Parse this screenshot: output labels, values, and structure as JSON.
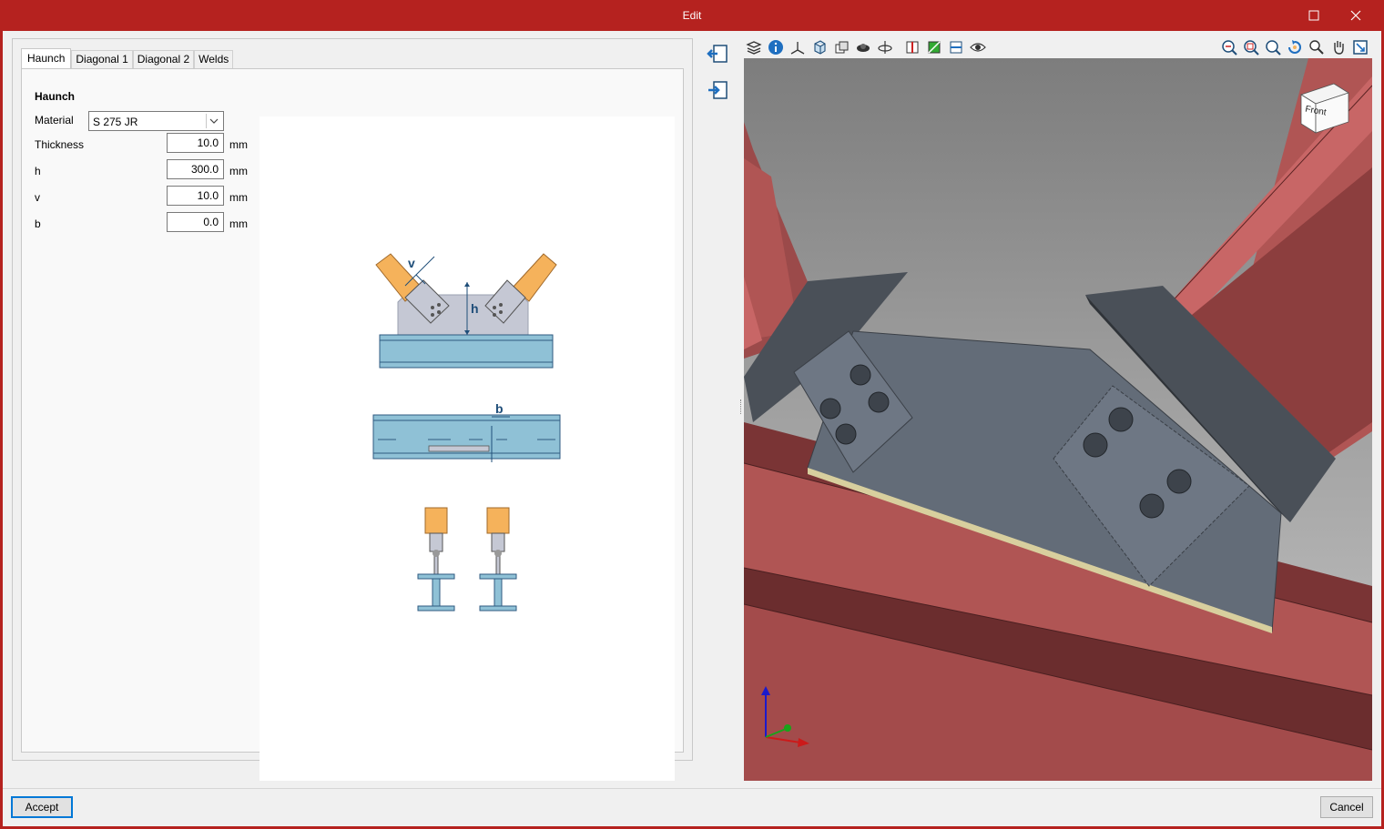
{
  "window": {
    "title": "Edit"
  },
  "tabs": [
    {
      "label": "Haunch",
      "active": true
    },
    {
      "label": "Diagonal 1",
      "active": false
    },
    {
      "label": "Diagonal 2",
      "active": false
    },
    {
      "label": "Welds",
      "active": false
    }
  ],
  "haunch": {
    "section_title": "Haunch",
    "material": {
      "label": "Material",
      "value": "S 275 JR"
    },
    "fields": [
      {
        "label": "Thickness",
        "value": "10.0",
        "unit": "mm"
      },
      {
        "label": "h",
        "value": "300.0",
        "unit": "mm"
      },
      {
        "label": "v",
        "value": "10.0",
        "unit": "mm"
      },
      {
        "label": "b",
        "value": "0.0",
        "unit": "mm"
      }
    ]
  },
  "figure": {
    "label_v": "v",
    "label_h": "h",
    "label_b": "b"
  },
  "viewport": {
    "view_cube_label": "Front"
  },
  "footer": {
    "accept_label": "Accept",
    "cancel_label": "Cancel"
  },
  "colors": {
    "titlebar": "#b5221f",
    "beam_red": "#b05554",
    "plate_gray": "#636c78",
    "diagonal_orange": "#f5b25b",
    "beam_blue": "#8fc1d6"
  }
}
